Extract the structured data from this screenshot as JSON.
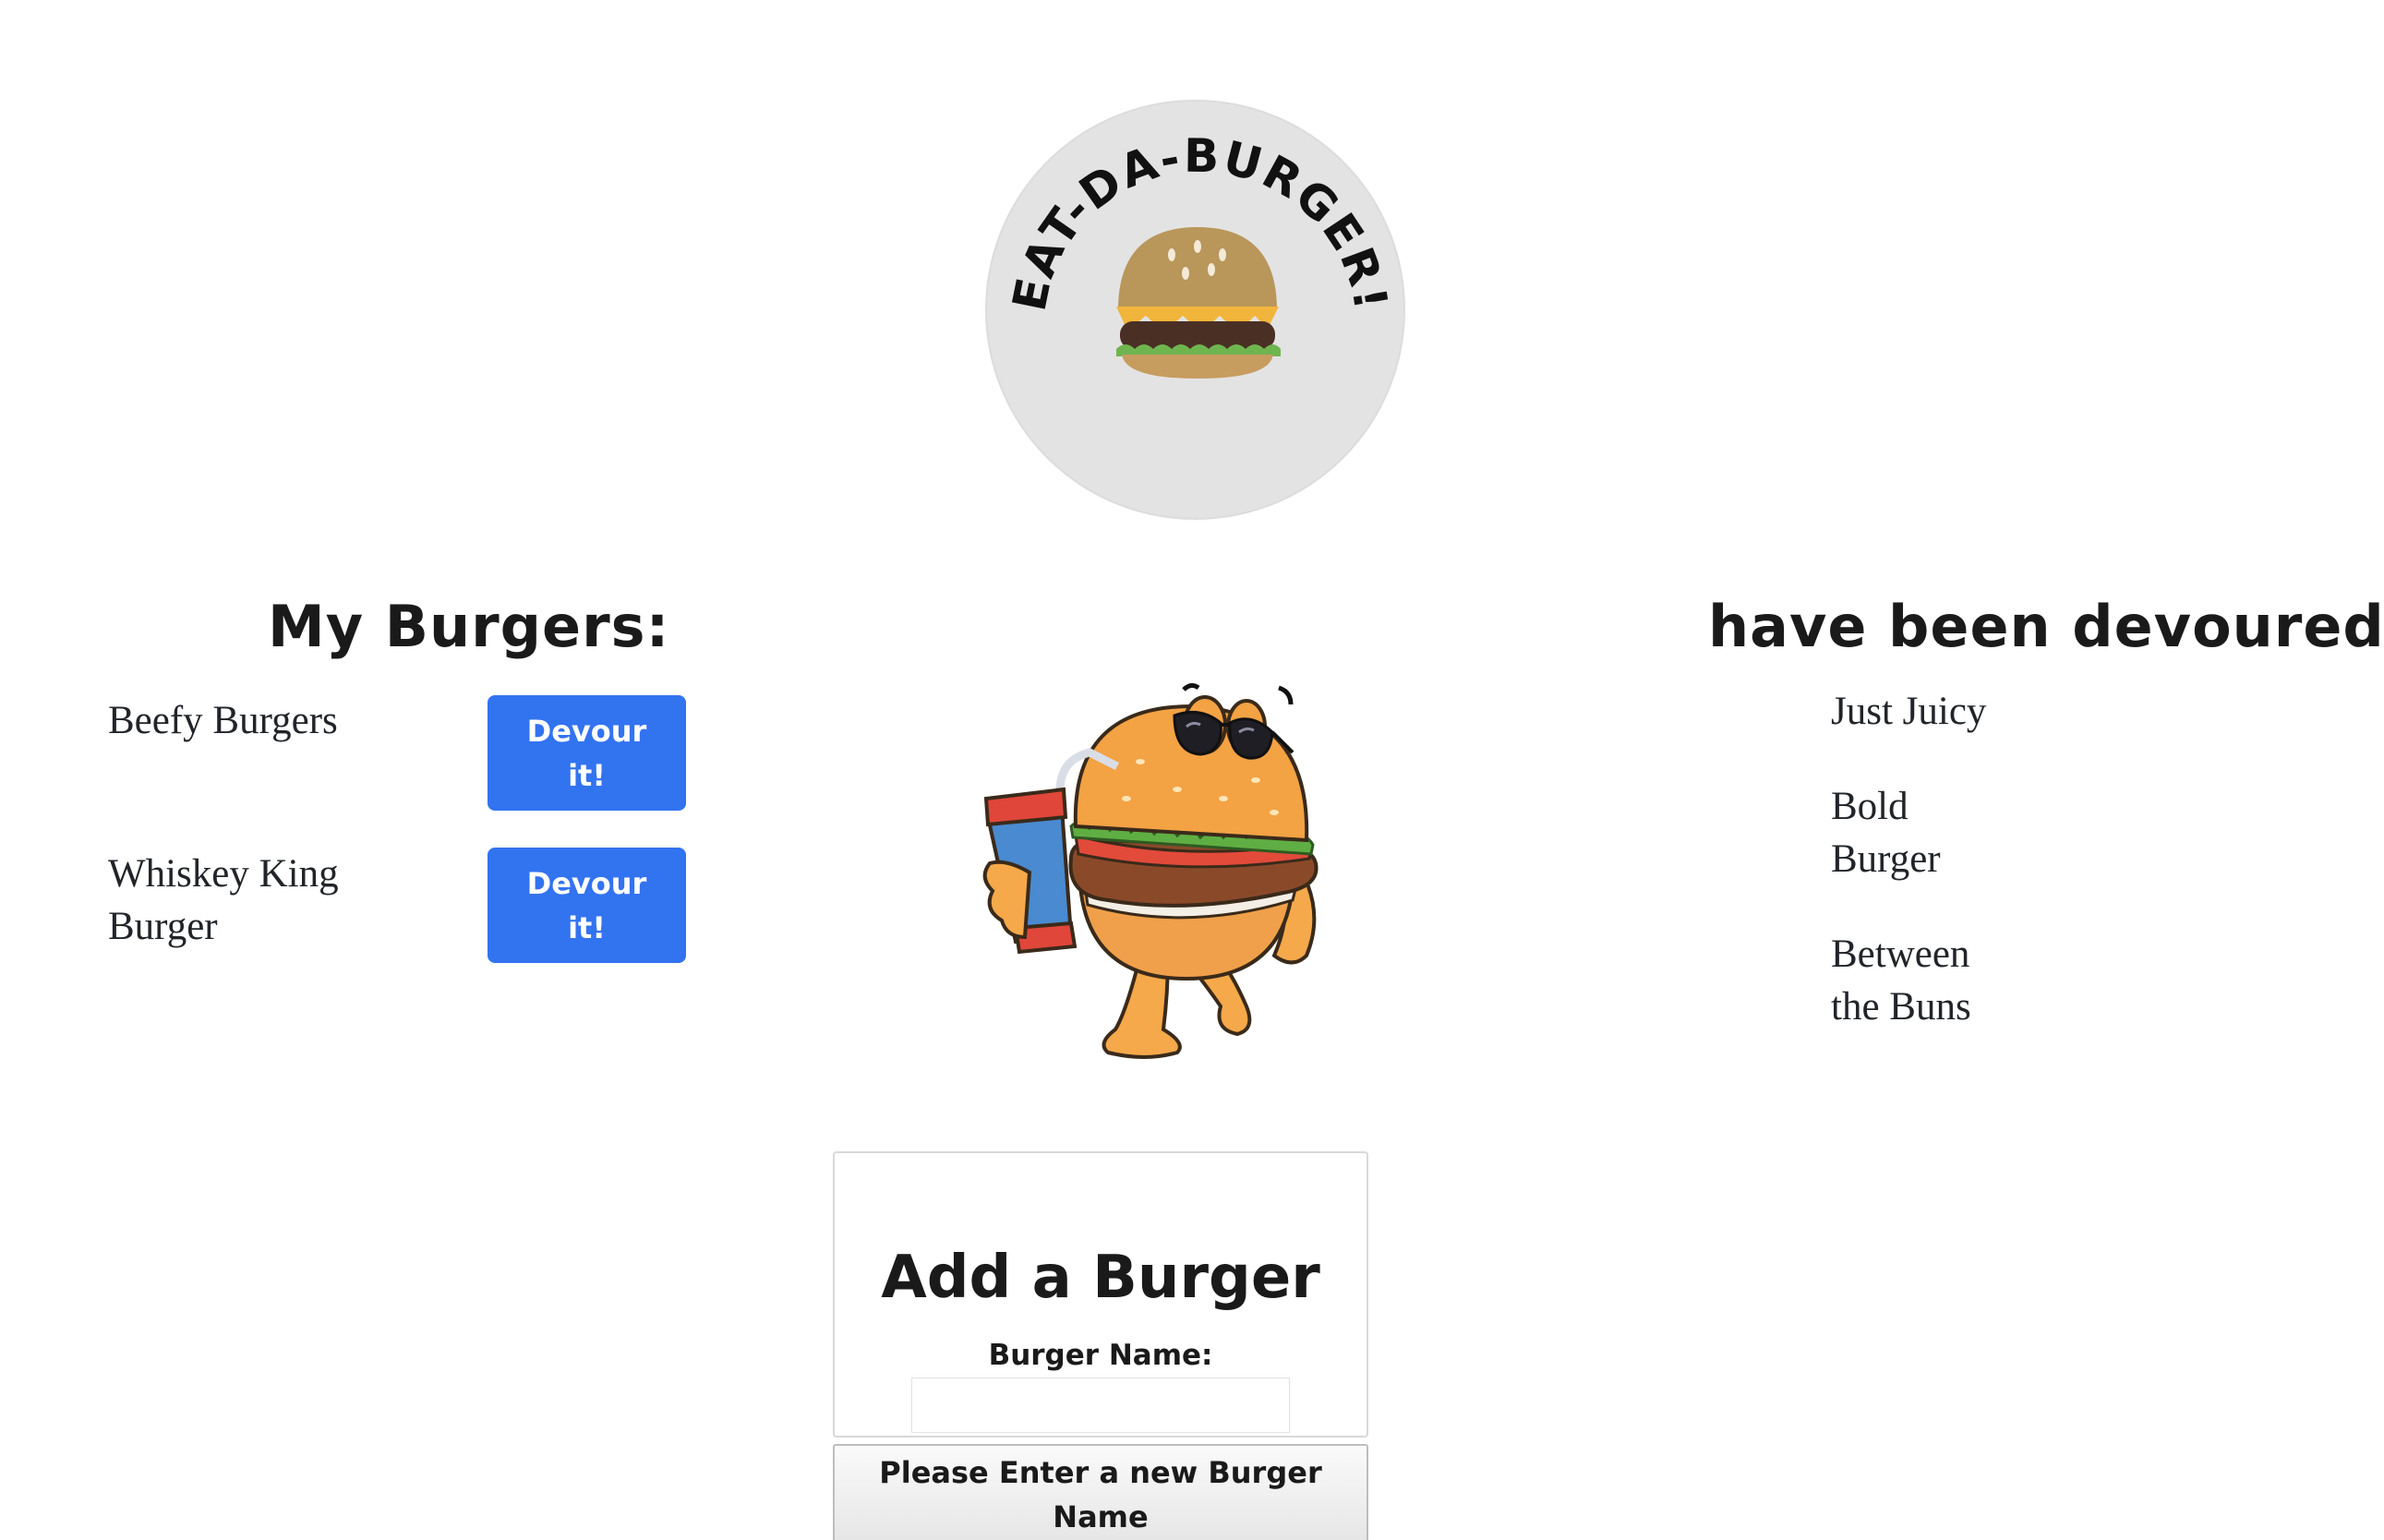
{
  "logo": {
    "text": "EAT-DA-BURGER!",
    "icon": "burger-icon"
  },
  "my_burgers": {
    "title": "My Burgers:",
    "items": [
      {
        "name": "Beefy Burgers",
        "button_label": "Devour it!"
      },
      {
        "name": "Whiskey King Burger",
        "button_label": "Devour it!"
      }
    ]
  },
  "mascot": {
    "icon": "burger-mascot-illustration"
  },
  "devoured": {
    "title": "have been devoured:",
    "items": [
      {
        "name": "Just Juicy"
      },
      {
        "name": "Bold Burger"
      },
      {
        "name": "Between the Buns"
      }
    ]
  },
  "add_form": {
    "title": "Add a Burger",
    "label": "Burger Name:",
    "input_value": "",
    "submit_label": "Please Enter a new Burger Name"
  },
  "colors": {
    "button_blue": "#3273f0",
    "logo_gray": "#e3e3e3",
    "text": "#212529"
  }
}
